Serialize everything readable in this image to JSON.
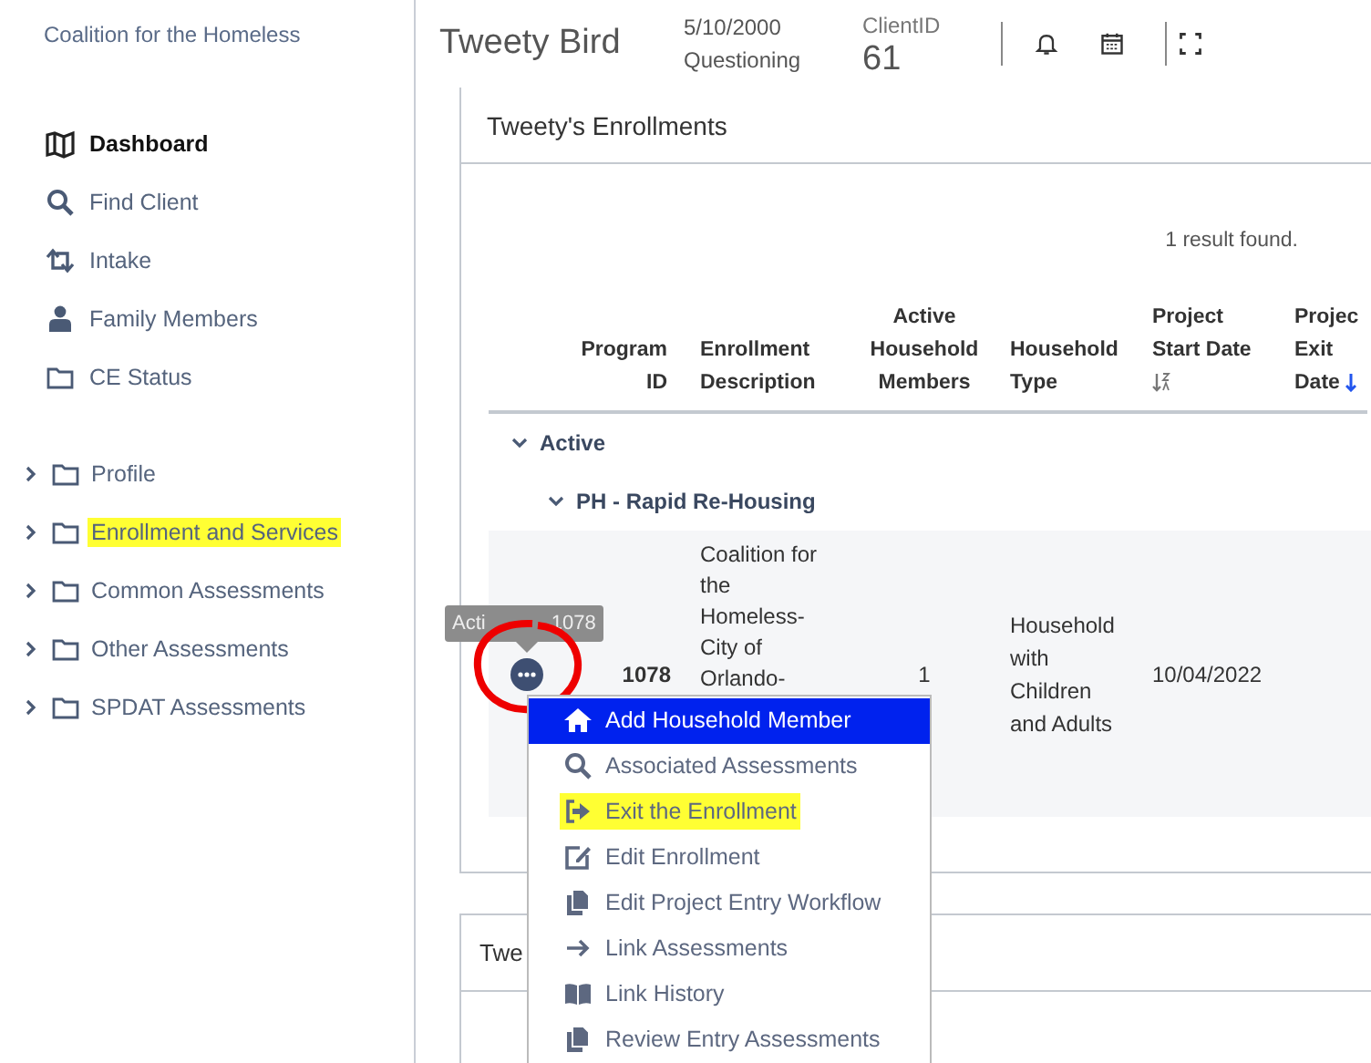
{
  "sidebar": {
    "org": "Coalition for the Homeless",
    "items": [
      {
        "kind": "link",
        "label": "Dashboard",
        "selected": true,
        "highlighted": false
      },
      {
        "kind": "link",
        "label": "Find Client",
        "selected": false,
        "highlighted": false
      },
      {
        "kind": "link",
        "label": "Intake",
        "selected": false,
        "highlighted": false
      },
      {
        "kind": "link",
        "label": "Family Members",
        "selected": false,
        "highlighted": false
      },
      {
        "kind": "link",
        "label": "CE Status",
        "selected": false,
        "highlighted": false
      },
      {
        "kind": "folder",
        "label": "Profile",
        "expanded": false,
        "highlighted": false
      },
      {
        "kind": "folder",
        "label": "Enrollment and Services",
        "expanded": false,
        "highlighted": true
      },
      {
        "kind": "folder",
        "label": "Common Assessments",
        "expanded": false,
        "highlighted": false
      },
      {
        "kind": "folder",
        "label": "Other Assessments",
        "expanded": false,
        "highlighted": false
      },
      {
        "kind": "folder",
        "label": "SPDAT Assessments",
        "expanded": false,
        "highlighted": false
      }
    ]
  },
  "header": {
    "name": "Tweety Bird",
    "dob": "5/10/2000",
    "gender": "Questioning",
    "client_id_label": "ClientID",
    "client_id": "61"
  },
  "enrollments": {
    "title": "Tweety's Enrollments",
    "result_count": "1 result found.",
    "columns": [
      {
        "label": "Program ID",
        "sortable": false
      },
      {
        "label": "Enrollment Description",
        "sortable": false
      },
      {
        "label": "Active Household Members",
        "sortable": false
      },
      {
        "label": "Household Type",
        "sortable": false
      },
      {
        "label": "Project Start Date",
        "sortable": true,
        "sorted": false
      },
      {
        "label": "Projec Exit Date",
        "sortable": true,
        "sorted": true
      }
    ],
    "groups": [
      {
        "label": "Active",
        "expanded": true,
        "children": [
          {
            "label": "PH - Rapid Re-Housing",
            "expanded": true,
            "rows": [
              {
                "program_id": "1078",
                "description": "Coalition for the Homeless-City of Orlando-",
                "active_members": "1",
                "household_type": "Household with Children and Adults",
                "start_date": "10/04/2022",
                "circled": true,
                "tooltip": [
                  "Acti",
                  "1078"
                ]
              }
            ]
          }
        ]
      }
    ]
  },
  "second_card": {
    "title": "Twe"
  },
  "menu": {
    "items": [
      {
        "label": "Add Household Member",
        "selected": true,
        "highlighted": false
      },
      {
        "label": "Associated Assessments",
        "selected": false,
        "highlighted": false
      },
      {
        "label": "Exit the Enrollment",
        "selected": false,
        "highlighted": true
      },
      {
        "label": "Edit Enrollment",
        "selected": false,
        "highlighted": false
      },
      {
        "label": "Edit Project Entry Workflow",
        "selected": false,
        "highlighted": false
      },
      {
        "label": "Link Assessments",
        "selected": false,
        "highlighted": false
      },
      {
        "label": "Link History",
        "selected": false,
        "highlighted": false
      },
      {
        "label": "Review Entry Assessments",
        "selected": false,
        "highlighted": false
      }
    ]
  }
}
